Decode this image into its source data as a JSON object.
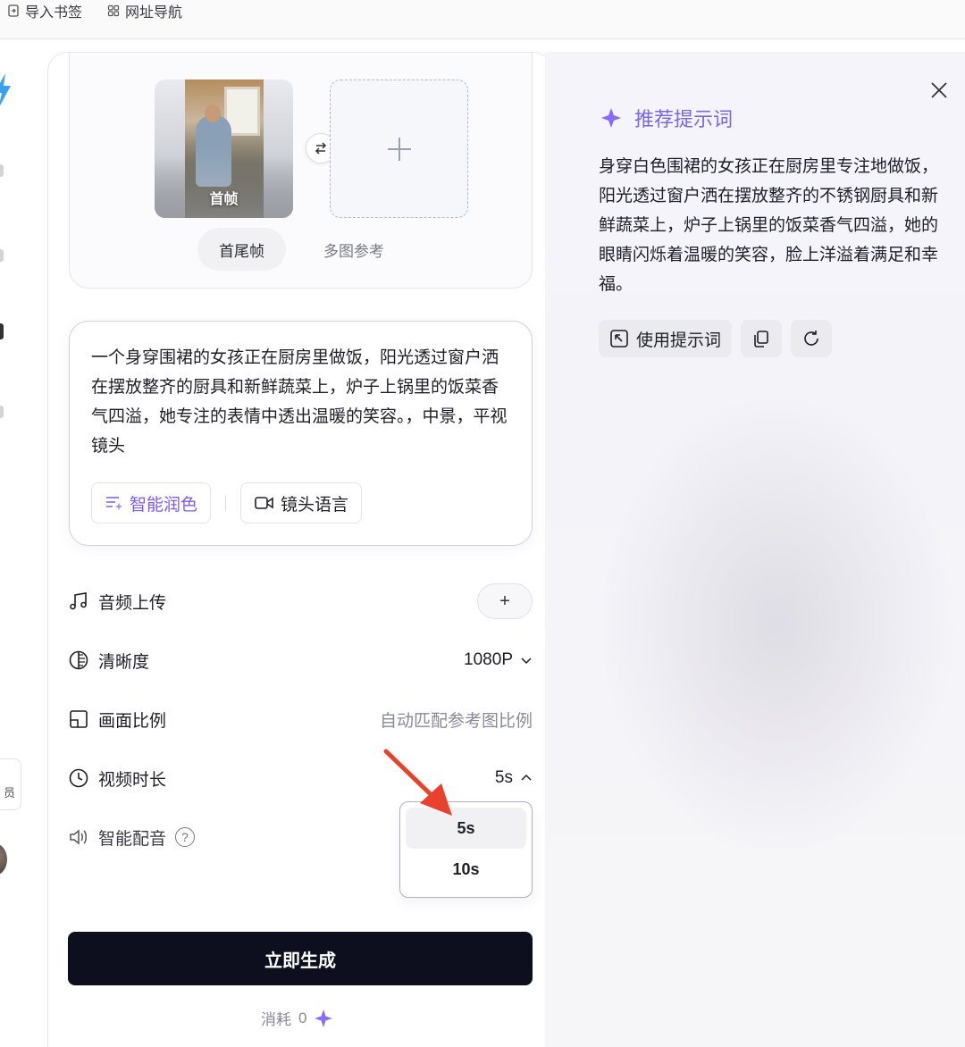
{
  "bookmarks": {
    "import_label": "导入书签",
    "nav_label": "网址导航"
  },
  "rail": {
    "member_label": "员"
  },
  "frames": {
    "first_frame_label": "首帧",
    "tabs": [
      {
        "label": "首尾帧",
        "active": true
      },
      {
        "label": "多图参考",
        "active": false
      }
    ]
  },
  "prompt": {
    "text": "一个身穿围裙的女孩正在厨房里做饭，阳光透过窗户洒在摆放整齐的厨具和新鲜蔬菜上，炉子上锅里的饭菜香气四溢，她专注的表情中透出温暖的笑容。，中景，平视镜头",
    "polish_label": "智能润色",
    "camera_label": "镜头语言"
  },
  "settings": {
    "audio_upload": {
      "label": "音频上传"
    },
    "resolution": {
      "label": "清晰度",
      "value": "1080P"
    },
    "aspect_ratio": {
      "label": "画面比例",
      "value": "自动匹配参考图比例"
    },
    "duration": {
      "label": "视频时长",
      "value": "5s"
    },
    "dubbing": {
      "label": "智能配音"
    }
  },
  "duration_dropdown": {
    "options": [
      {
        "label": "5s",
        "selected": true
      },
      {
        "label": "10s",
        "selected": false
      }
    ]
  },
  "generate": {
    "label": "立即生成",
    "cost_label": "消耗",
    "cost_value": "0"
  },
  "recommend": {
    "title": "推荐提示词",
    "text": "身穿白色围裙的女孩正在厨房里专注地做饭，阳光透过窗户洒在摆放整齐的不锈钢厨具和新鲜蔬菜上，炉子上锅里的饭菜香气四溢，她的眼睛闪烁着温暖的笑容，脸上洋溢着满足和幸福。",
    "use_label": "使用提示词"
  },
  "colors": {
    "accent_purple": "#7a67e8",
    "primary_button": "#0d0f1f",
    "annotation_arrow": "#e8412c"
  }
}
